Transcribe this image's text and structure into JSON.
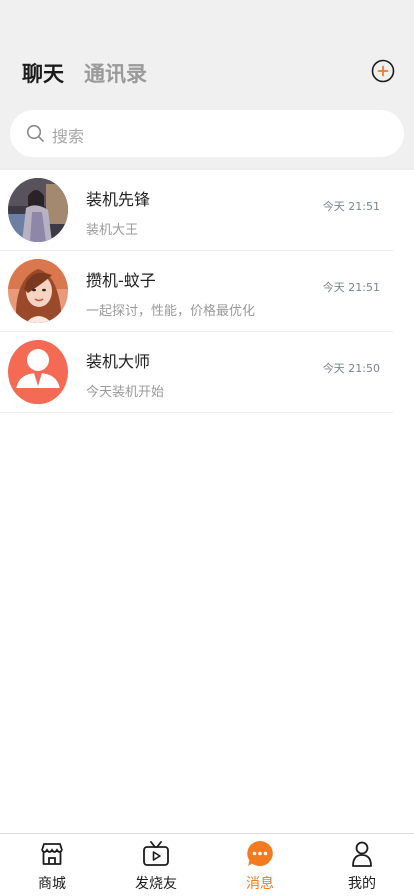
{
  "header": {
    "tabs": [
      {
        "label": "聊天",
        "active": true
      },
      {
        "label": "通讯录",
        "active": false
      }
    ],
    "add_icon": "plus-circle-icon"
  },
  "search": {
    "placeholder": "搜索",
    "icon": "search-icon"
  },
  "chats": [
    {
      "name": "装机先锋",
      "preview": "装机大王",
      "time": "今天 21:51",
      "avatar": "photo-woman-dark"
    },
    {
      "name": "攒机-蚊子",
      "preview": "一起探讨，性能，价格最优化",
      "time": "今天 21:51",
      "avatar": "photo-woman-light"
    },
    {
      "name": "装机大师",
      "preview": "今天装机开始",
      "time": "今天 21:50",
      "avatar": "default-user-avatar"
    }
  ],
  "bottom_nav": [
    {
      "label": "商城",
      "icon": "shop-icon",
      "active": false
    },
    {
      "label": "发烧友",
      "icon": "tv-icon",
      "active": false
    },
    {
      "label": "消息",
      "icon": "message-icon",
      "active": true
    },
    {
      "label": "我的",
      "icon": "person-icon",
      "active": false
    }
  ],
  "colors": {
    "accent": "#f47a1f",
    "header_bg": "#f0f0f0",
    "default_avatar": "#f46a55"
  }
}
